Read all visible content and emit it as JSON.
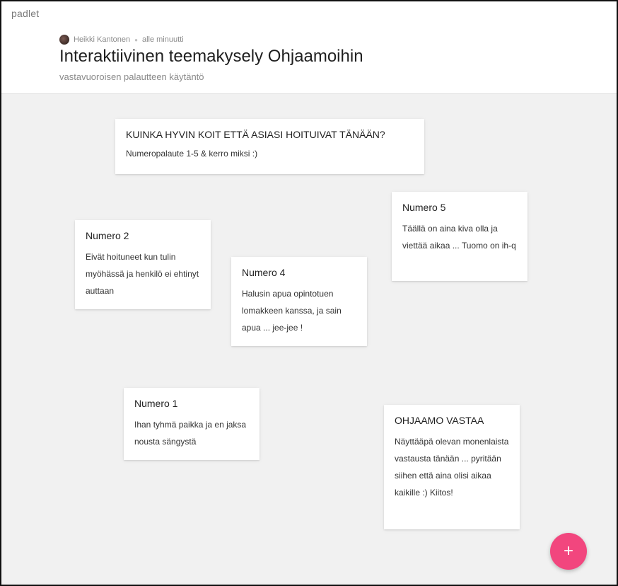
{
  "header": {
    "logo": "padlet",
    "author": "Heikki Kantonen",
    "timestamp": "alle minuutti",
    "title": "Interaktiivinen teemakysely Ohjaamoihin",
    "subtitle": "vastavuoroisen palautteen käytäntö"
  },
  "cards": [
    {
      "title": "KUINKA HYVIN KOIT ETTÄ ASIASI HOITUIVAT TÄNÄÄN?",
      "body": "Numeropalaute 1-5 & kerro miksi :)"
    },
    {
      "title": "Numero 5",
      "body": "Täällä on aina kiva olla ja viettää aikaa ... Tuomo on ih-q"
    },
    {
      "title": "Numero 2",
      "body": "Eivät hoituneet kun tulin myöhässä ja henkilö ei ehtinyt auttaan"
    },
    {
      "title": "Numero 4",
      "body": "Halusin apua opintotuen lomakkeen kanssa, ja sain apua ... jee-jee !"
    },
    {
      "title": "Numero 1",
      "body": "Ihan tyhmä paikka ja en jaksa nousta sängystä"
    },
    {
      "title": "OHJAAMO VASTAA",
      "body": "Näyttääpä olevan monenlaista vastausta tänään ... pyritään siihen että aina olisi aikaa kaikille :) Kiitos!"
    }
  ],
  "fab": {
    "label": "+",
    "icon": "plus-icon"
  },
  "colors": {
    "accent": "#f2467e",
    "canvas": "#f1f1f1"
  }
}
